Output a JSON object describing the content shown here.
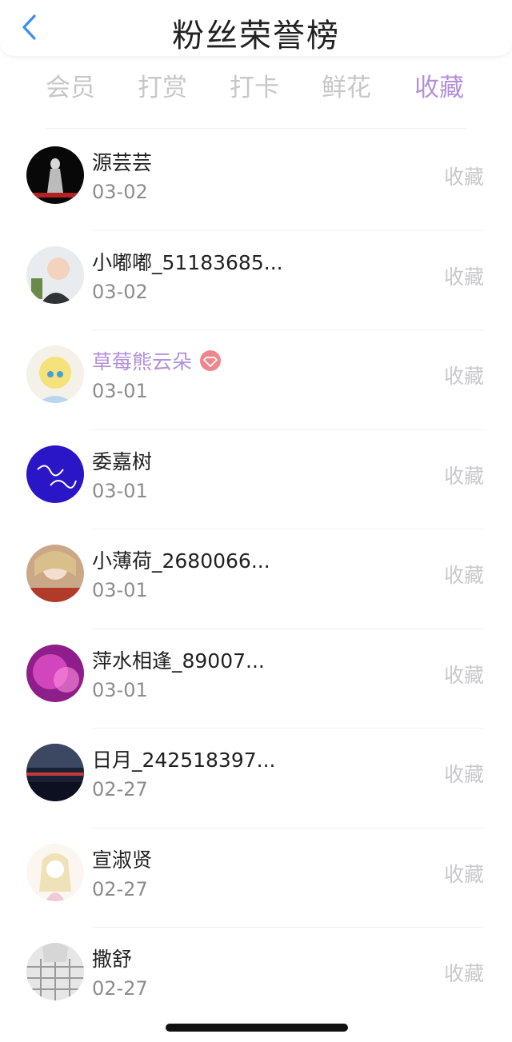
{
  "header": {
    "title": "粉丝荣誉榜"
  },
  "tabs": [
    {
      "label": "会员",
      "active": false
    },
    {
      "label": "打赏",
      "active": false
    },
    {
      "label": "打卡",
      "active": false
    },
    {
      "label": "鲜花",
      "active": false
    },
    {
      "label": "收藏",
      "active": true
    }
  ],
  "accent_color": "#b390d9",
  "list": [
    {
      "name": "源芸芸",
      "date": "03-02",
      "action": "收藏"
    },
    {
      "name": "小嘟嘟_51183685...",
      "date": "03-02",
      "action": "收藏"
    },
    {
      "name": "草莓熊云朵",
      "date": "03-01",
      "action": "收藏",
      "vip": true
    },
    {
      "name": "委嘉树",
      "date": "03-01",
      "action": "收藏"
    },
    {
      "name": "小薄荷_2680066...",
      "date": "03-01",
      "action": "收藏"
    },
    {
      "name": "萍水相逢_89007...",
      "date": "03-01",
      "action": "收藏"
    },
    {
      "name": "日月_242518397...",
      "date": "02-27",
      "action": "收藏"
    },
    {
      "name": "宣淑贤",
      "date": "02-27",
      "action": "收藏"
    },
    {
      "name": "撒舒",
      "date": "02-27",
      "action": "收藏"
    }
  ]
}
